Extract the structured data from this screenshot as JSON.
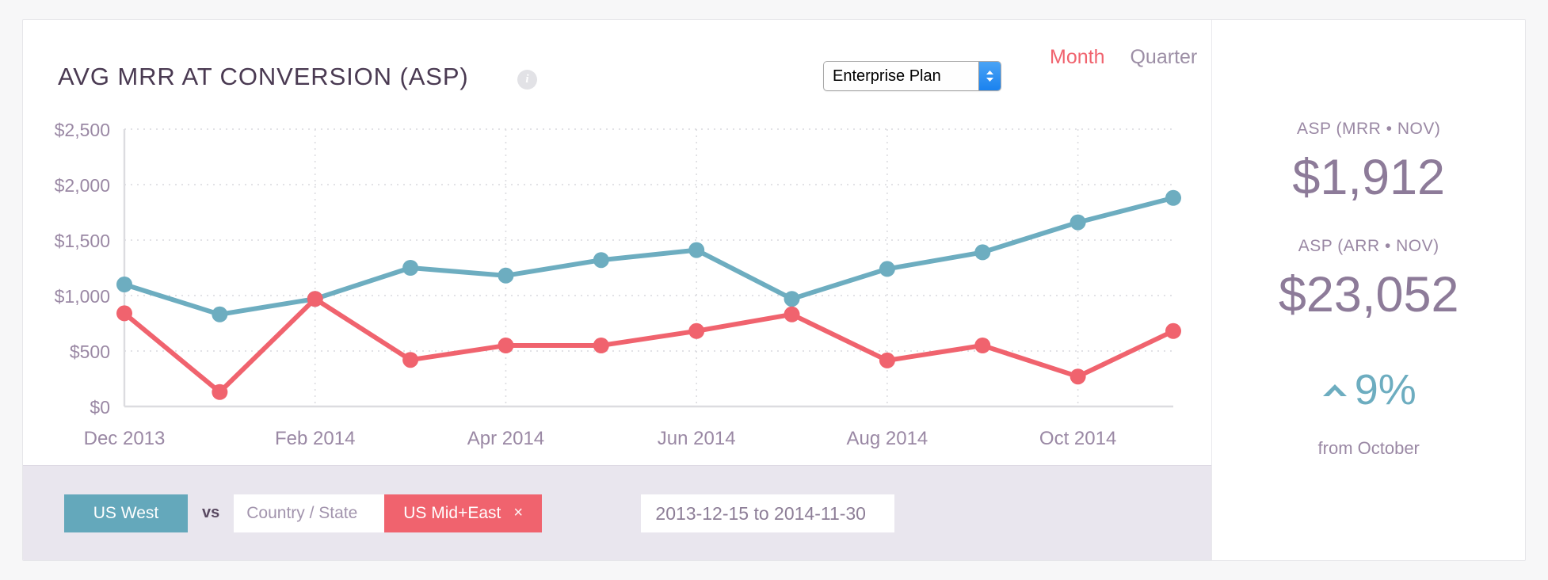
{
  "header": {
    "title": "AVG MRR AT CONVERSION (ASP)",
    "info_icon": "info-icon",
    "plan_select": {
      "value": "Enterprise Plan"
    },
    "tabs": [
      {
        "label": "Month",
        "active": true
      },
      {
        "label": "Quarter",
        "active": false
      }
    ]
  },
  "stats": [
    {
      "label": "ASP (MRR • NOV)",
      "value": "$1,912"
    },
    {
      "label": "ASP (ARR • NOV)",
      "value": "$23,052"
    }
  ],
  "delta": {
    "arrow": "up-caret-icon",
    "value": "9%",
    "sub": "from October",
    "color": "#6dadc0"
  },
  "filters": {
    "primary_segment": "US West",
    "vs_label": "vs",
    "country_state_placeholder": "Country / State",
    "compare_segment": "US Mid+East",
    "compare_remove": "×",
    "date_range": "2013-12-15 to 2014-11-30"
  },
  "colors": {
    "teal": "#6dadc0",
    "red": "#f0636e",
    "purple_text": "#8d7b99",
    "tab_active": "#f0636e",
    "filter_bar": "#e9e6ee"
  },
  "chart_data": {
    "type": "line",
    "title": "AVG MRR AT CONVERSION (ASP)",
    "xlabel": "",
    "ylabel": "",
    "ylim": [
      0,
      2500
    ],
    "ytick_values": [
      0,
      500,
      1000,
      1500,
      2000,
      2500
    ],
    "ytick_labels": [
      "$0",
      "$500",
      "$1,000",
      "$1,500",
      "$2,000",
      "$2,500"
    ],
    "x": [
      "Dec 2013",
      "Jan 2014",
      "Feb 2014",
      "Mar 2014",
      "Apr 2014",
      "May 2014",
      "Jun 2014",
      "Jul 2014",
      "Aug 2014",
      "Sep 2014",
      "Oct 2014",
      "Nov 2014"
    ],
    "xtick_labels": [
      "Dec 2013",
      "Feb 2014",
      "Apr 2014",
      "Jun 2014",
      "Aug 2014",
      "Oct 2014"
    ],
    "xtick_indices": [
      0,
      2,
      4,
      6,
      8,
      10
    ],
    "grid": true,
    "legend": "none",
    "series": [
      {
        "name": "US West",
        "color": "#6dadc0",
        "values": [
          1100,
          830,
          970,
          1250,
          1180,
          1320,
          1410,
          970,
          1240,
          1390,
          1660,
          1880
        ]
      },
      {
        "name": "US Mid+East",
        "color": "#f0636e",
        "values": [
          840,
          130,
          970,
          420,
          550,
          550,
          680,
          830,
          415,
          550,
          270,
          680
        ]
      }
    ]
  }
}
